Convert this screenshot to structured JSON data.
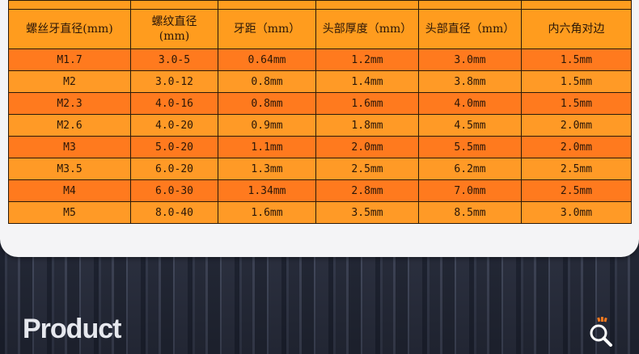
{
  "table": {
    "headers": [
      "螺丝牙直径(mm)",
      "螺纹直径\n(mm)",
      "牙距（mm）",
      "头部厚度（mm）",
      "头部直径（mm）",
      "内六角对边"
    ],
    "rows": [
      [
        "M1.7",
        "3.0-5",
        "0.64mm",
        "1.2mm",
        "3.0mm",
        "1.5mm"
      ],
      [
        "M2",
        "3.0-12",
        "0.8mm",
        "1.4mm",
        "3.8mm",
        "1.5mm"
      ],
      [
        "M2.3",
        "4.0-16",
        "0.8mm",
        "1.6mm",
        "4.0mm",
        "1.5mm"
      ],
      [
        "M2.6",
        "4.0-20",
        "0.9mm",
        "1.8mm",
        "4.5mm",
        "2.0mm"
      ],
      [
        "M3",
        "5.0-20",
        "1.1mm",
        "2.0mm",
        "5.5mm",
        "2.0mm"
      ],
      [
        "M3.5",
        "6.0-20",
        "1.3mm",
        "2.5mm",
        "6.2mm",
        "2.5mm"
      ],
      [
        "M4",
        "6.0-30",
        "1.34mm",
        "2.8mm",
        "7.0mm",
        "2.5mm"
      ],
      [
        "M5",
        "8.0-40",
        "1.6mm",
        "3.5mm",
        "8.5mm",
        "3.0mm"
      ]
    ]
  },
  "footer": {
    "title": "Product"
  },
  "colors": {
    "row_dark": "#ff7a1e",
    "row_light": "#ff9a26",
    "header": "#ff9c1e",
    "accent": "#ff7a1e"
  },
  "icons": {
    "corner_badge": "magnifier-icon"
  }
}
